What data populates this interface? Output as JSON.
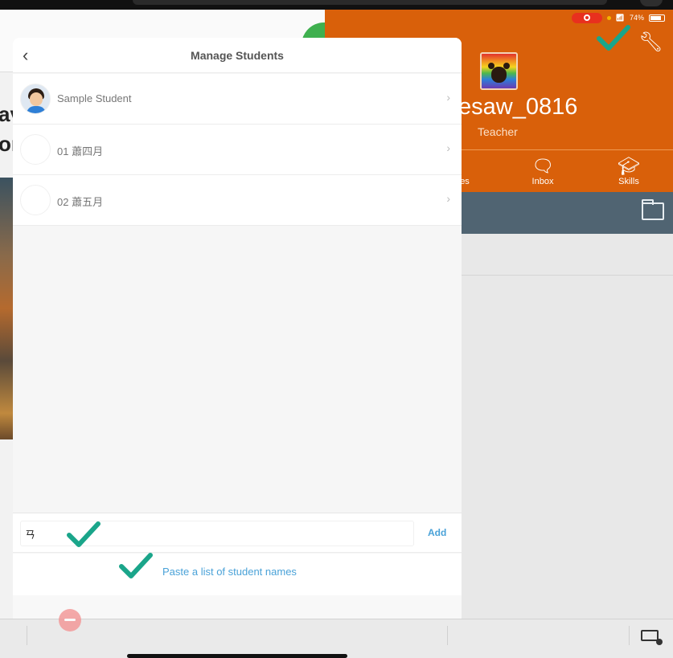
{
  "status_bar": {
    "battery": "74%"
  },
  "left_page": {
    "fragment_1": "av",
    "fragment_2": "or"
  },
  "profile": {
    "username": "esaw_0816",
    "role": "Teacher"
  },
  "nav": [
    {
      "label": "es",
      "icon": "people-icon"
    },
    {
      "label": "Inbox",
      "icon": "chat-icon"
    },
    {
      "label": "Skills",
      "icon": "graduation-cap-icon"
    }
  ],
  "modal": {
    "title": "Manage Students",
    "students": [
      {
        "name": "Sample Student",
        "avatar": "child-avatar"
      },
      {
        "name": "01 蕭四月",
        "avatar": "empty-avatar"
      },
      {
        "name": "02 蕭五月",
        "avatar": "empty-avatar"
      }
    ],
    "input_value": "ㄢ",
    "add_label": "Add",
    "paste_label": "Paste a list of student names"
  },
  "colors": {
    "accent_orange": "#d9600a",
    "link_blue": "#4aa2d8",
    "check_teal": "#1aa58a"
  }
}
